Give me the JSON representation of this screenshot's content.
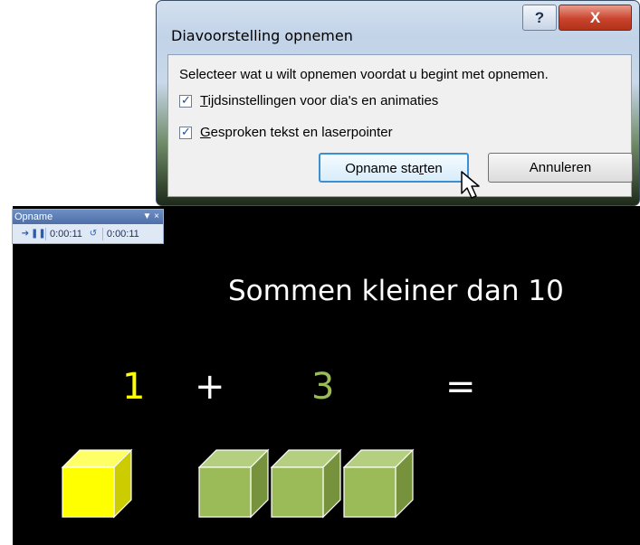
{
  "dialog": {
    "title": "Diavoorstelling opnemen",
    "help_label": "?",
    "close_label": "X",
    "instruction": "Selecteer wat u wilt opnemen voordat u begint met opnemen.",
    "options": [
      {
        "mnemonic": "T",
        "rest": "ijdsinstellingen voor dia's en animaties",
        "checked": true
      },
      {
        "mnemonic": "G",
        "rest": "esproken tekst en laserpointer",
        "checked": true
      }
    ],
    "start_button": {
      "before": "Opname sta",
      "mnemonic": "r",
      "after": "ten"
    },
    "cancel_label": "Annuleren"
  },
  "recording_toolbar": {
    "title": "Opname",
    "next_icon": "next-arrow-icon",
    "pause_icon": "pause-icon",
    "slide_time": "0:00:11",
    "repeat_icon": "repeat-icon",
    "total_time": "0:00:11"
  },
  "slide": {
    "title": "Sommen kleiner dan 10",
    "equation": {
      "a": "1",
      "plus": "+",
      "b": "3",
      "equals": "="
    },
    "cubes": {
      "yellow_count": 1,
      "green_count": 3
    },
    "colors": {
      "background": "#000000",
      "yellow": "#ffff00",
      "green": "#9bbb59"
    }
  }
}
